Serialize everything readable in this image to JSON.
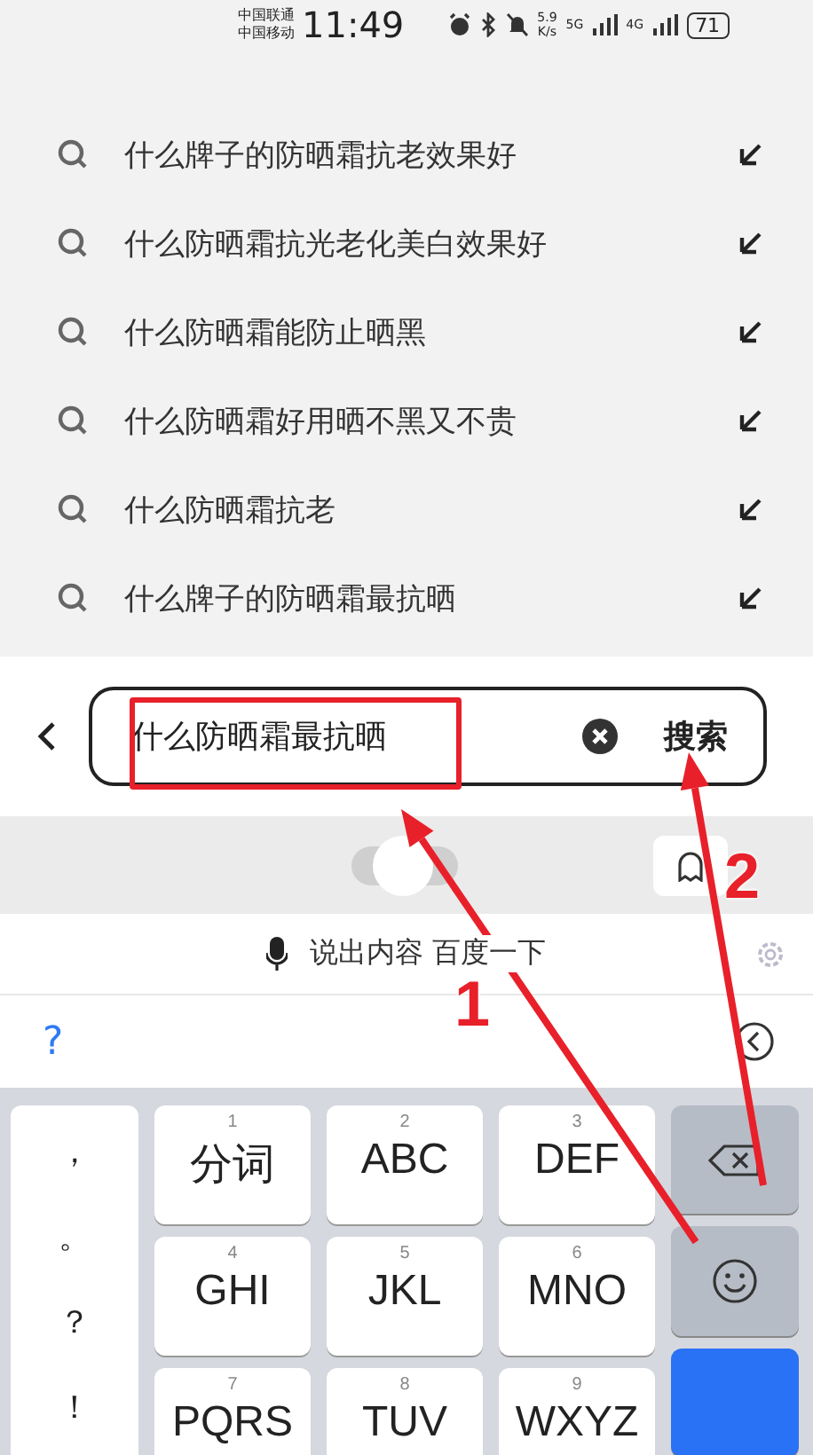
{
  "status_bar": {
    "carriers": [
      "中国联通",
      "中国移动"
    ],
    "time": "11:49",
    "speed": "5.9",
    "speed_unit": "K/s",
    "networks": [
      "5G",
      "4G"
    ],
    "battery": "71"
  },
  "suggestions": [
    "什么牌子的防晒霜抗老效果好",
    "什么防晒霜抗光老化美白效果好",
    "什么防晒霜能防止晒黑",
    "什么防晒霜好用晒不黑又不贵",
    "什么防晒霜抗老",
    "什么牌子的防晒霜最抗晒"
  ],
  "search": {
    "value": "什么防晒霜最抗晒",
    "button": "搜索"
  },
  "toolbar": {
    "toggle_on": false
  },
  "voice": {
    "label": "说出内容 百度一下"
  },
  "candidate": {
    "symbol": "?"
  },
  "keyboard": {
    "punctuation": [
      "，",
      "。",
      "？",
      "！"
    ],
    "keys": [
      {
        "number": "1",
        "label": "分词"
      },
      {
        "number": "2",
        "label": "ABC"
      },
      {
        "number": "3",
        "label": "DEF"
      },
      {
        "number": "4",
        "label": "GHI"
      },
      {
        "number": "5",
        "label": "JKL"
      },
      {
        "number": "6",
        "label": "MNO"
      },
      {
        "number": "7",
        "label": "PQRS"
      },
      {
        "number": "8",
        "label": "TUV"
      },
      {
        "number": "9",
        "label": "WXYZ"
      }
    ]
  },
  "annotations": [
    {
      "label": "1"
    },
    {
      "label": "2"
    }
  ]
}
